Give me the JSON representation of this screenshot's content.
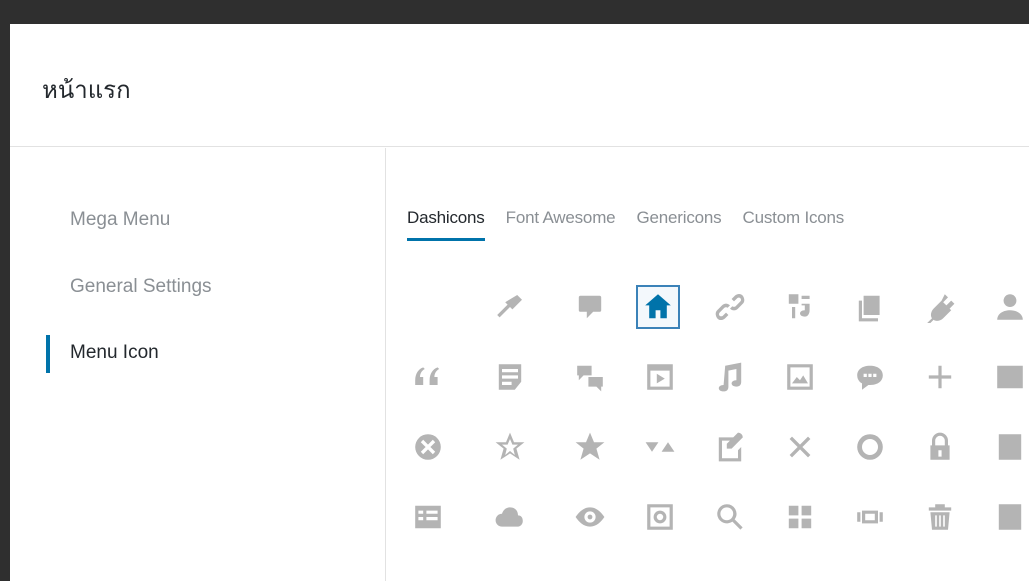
{
  "modal": {
    "title": "หน้าแรก"
  },
  "sidebar": {
    "items": [
      {
        "label": "Mega Menu"
      },
      {
        "label": "General Settings"
      },
      {
        "label": "Menu Icon"
      }
    ]
  },
  "tabs": [
    {
      "label": "Dashicons"
    },
    {
      "label": "Font Awesome"
    },
    {
      "label": "Genericons"
    },
    {
      "label": "Custom Icons"
    }
  ],
  "icons": {
    "rows": [
      [
        "admin-appearance-icon",
        "admin-comments-icon",
        "admin-home-icon",
        "admin-links-icon",
        "admin-media-icon",
        "admin-page-icon",
        "admin-plugins-icon",
        "admin-users-icon"
      ],
      [
        "quote-icon",
        "format-aside-icon",
        "format-chat-icon",
        "format-video-icon",
        "format-audio-icon",
        "format-image-icon",
        "format-status-icon",
        "plus-icon",
        "list-icon"
      ],
      [
        "dismiss-icon",
        "star-empty-icon",
        "star-filled-icon",
        "arrows-icon",
        "edit-page-icon",
        "no-alt-icon",
        "marker-icon",
        "lock-icon",
        "book-icon"
      ],
      [
        "list-view-icon",
        "cloud-icon",
        "visibility-icon",
        "vault-icon",
        "search-icon",
        "dashboard-icon",
        "slides-icon",
        "trash-icon",
        "clipboard-icon"
      ]
    ],
    "selected": "admin-home-icon",
    "colors": {
      "default": "#b4b4b4",
      "selected": "#0073aa",
      "accent": "#0073aa"
    }
  }
}
